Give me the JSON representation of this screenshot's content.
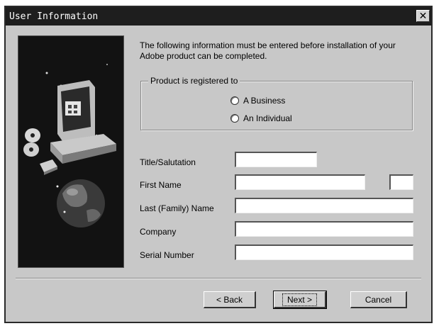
{
  "window": {
    "title": "User Information",
    "close_glyph": "✕"
  },
  "intro": {
    "text": "The following information must be entered before installation of your Adobe product can be completed."
  },
  "registration": {
    "legend": "Product is registered to",
    "options": [
      {
        "label": "A Business",
        "selected": false
      },
      {
        "label": "An Individual",
        "selected": false
      }
    ]
  },
  "form": {
    "title_label": "Title/Salutation",
    "title_value": "",
    "first_name_label": "First Name",
    "first_name_value": "",
    "middle_initial_value": "",
    "last_name_label": "Last (Family) Name",
    "last_name_value": "",
    "company_label": "Company",
    "company_value": "",
    "serial_label": "Serial Number",
    "serial_value": ""
  },
  "buttons": {
    "back_label": "< Back",
    "next_label": "Next >",
    "cancel_label": "Cancel"
  },
  "icons": {
    "side_art": "computer-illustration-icon",
    "globe": "globe-icon",
    "discs": "cd-discs-icon"
  }
}
